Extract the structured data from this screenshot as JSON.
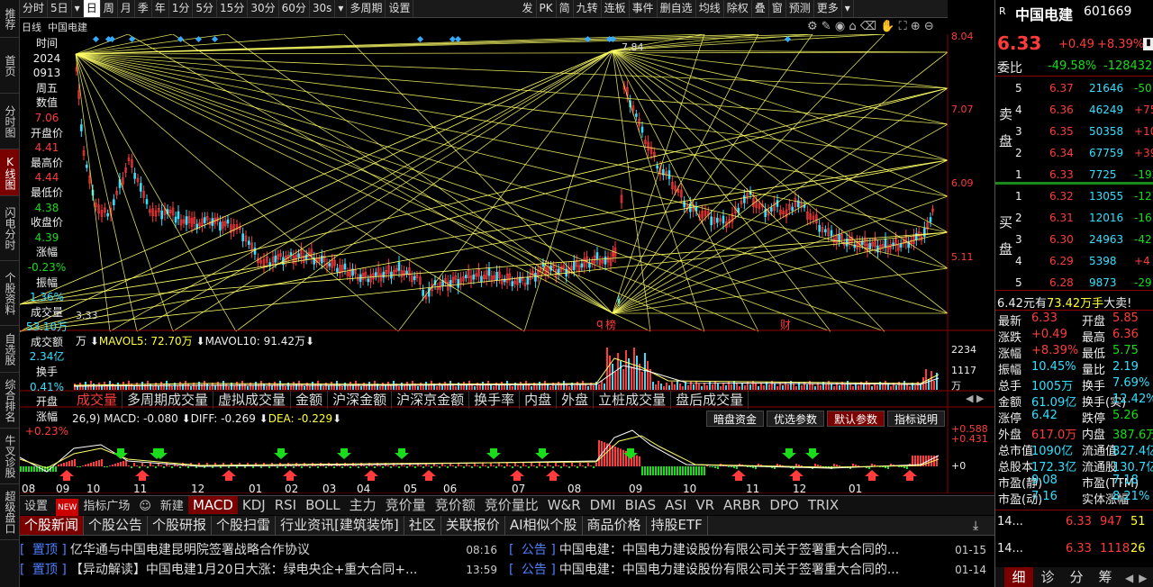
{
  "leftnav": [
    "推荐",
    "首页",
    "分时图",
    "K线图",
    "闪电分时",
    "个股资料",
    "自选股",
    "综合排名",
    "牛叉诊股",
    "超级盘口"
  ],
  "toolbar": {
    "periods": [
      "分时",
      "5日",
      "日",
      "周",
      "月",
      "季",
      "年",
      "1分",
      "5分",
      "15分",
      "30分",
      "60分",
      "30s",
      "多周期",
      "设置"
    ],
    "right": [
      "发",
      "PK",
      "简",
      "九转",
      "连板",
      "事件",
      "删自选",
      "均线",
      "除权",
      "叠",
      "窗",
      "预测",
      "更多"
    ]
  },
  "chart": {
    "label_period": "日线",
    "label_name": "中国电建",
    "y_ticks": [
      "8.04",
      "7.07",
      "6.09",
      "5.11"
    ],
    "x_ticks": [
      "08",
      "09",
      "10",
      "11",
      "12",
      "01",
      "02",
      "03",
      "04",
      "05",
      "06",
      "07",
      "08",
      "09",
      "10",
      "11",
      "12",
      "01"
    ],
    "high_label": "7.84",
    "low_label": "3.33",
    "marks": [
      "q",
      "榜",
      "财"
    ]
  },
  "infocol": [
    {
      "t": "时间",
      "c": "wht"
    },
    {
      "t": "2024",
      "c": "wht"
    },
    {
      "t": "0913",
      "c": "wht"
    },
    {
      "t": "周五",
      "c": "wht"
    },
    {
      "t": "数值",
      "c": "wht"
    },
    {
      "t": "7.06",
      "c": "red"
    },
    {
      "t": "开盘价",
      "c": "wht"
    },
    {
      "t": "4.41",
      "c": "red"
    },
    {
      "t": "最高价",
      "c": "wht"
    },
    {
      "t": "4.44",
      "c": "red"
    },
    {
      "t": "最低价",
      "c": "wht"
    },
    {
      "t": "4.38",
      "c": "grn"
    },
    {
      "t": "收盘价",
      "c": "wht"
    },
    {
      "t": "4.39",
      "c": "grn"
    },
    {
      "t": "涨幅",
      "c": "wht"
    },
    {
      "t": "-0.23%",
      "c": "grn"
    },
    {
      "t": "振幅",
      "c": "wht"
    },
    {
      "t": "1.36%",
      "c": "cyn"
    },
    {
      "t": "成交量",
      "c": "wht"
    },
    {
      "t": "53.10万",
      "c": "cyn"
    },
    {
      "t": "成交额",
      "c": "wht"
    },
    {
      "t": "2.34亿",
      "c": "cyn"
    },
    {
      "t": "换手",
      "c": "wht"
    },
    {
      "t": "0.41%",
      "c": "cyn"
    },
    {
      "t": "开盘",
      "c": "wht"
    },
    {
      "t": "涨幅",
      "c": "wht"
    },
    {
      "t": "+0.23%",
      "c": "red"
    }
  ],
  "volume": {
    "legend_prefix": "万",
    "mavol5": "MAVOL5: 72.70万",
    "mavol10": "MAVOL10: 91.42万",
    "y_ticks": [
      "2234",
      "1117",
      "万"
    ],
    "tabs": [
      "成交量",
      "多周期成交量",
      "虚拟成交量",
      "金额",
      "沪深金额",
      "沪深京金额",
      "换手率",
      "内盘",
      "外盘",
      "立桩成交量",
      "盘后成交量"
    ]
  },
  "macd": {
    "params": "26,9)",
    "macd": "MACD: -0.080",
    "diff": "DIFF: -0.269",
    "dea": "DEA: -0.229",
    "buttons": [
      "暗盘资金",
      "优选参数",
      "默认参数",
      "指标说明"
    ],
    "y_ticks": [
      "+0.588",
      "+0.431",
      "+0"
    ]
  },
  "indicator_tabs": [
    "设置",
    "指标广场",
    "新建",
    "MACD",
    "KDJ",
    "RSI",
    "BOLL",
    "主力",
    "竞价量",
    "竞价额",
    "竞价量比",
    "W&R",
    "DMI",
    "BIAS",
    "ASI",
    "VR",
    "ARBR",
    "DPO",
    "TRIX"
  ],
  "new_badge": "NEW",
  "news_tabs": [
    "个股新闻",
    "个股公告",
    "个股研报",
    "个股扫雷",
    "行业资讯[建筑装饰]",
    "社区",
    "关联报价",
    "AI相似个股",
    "商品价格",
    "持股ETF"
  ],
  "news_left": [
    {
      "tag": "置顶",
      "title": "亿华通与中国电建昆明院签署战略合作协议",
      "time": "08:16"
    },
    {
      "tag": "置顶",
      "title": "【异动解读】中国电建1月20日大涨：绿电央企+重大合同+...",
      "time": "13:59"
    }
  ],
  "news_right": [
    {
      "tag": "公告",
      "title": "中国电建：中国电力建设股份有限公司关于签署重大合同的...",
      "time": "01-15"
    },
    {
      "tag": "公告",
      "title": "中国电建：中国电力建设股份有限公司关于签署重大合同的...",
      "time": "01-14"
    }
  ],
  "quote": {
    "r": "R",
    "name": "中国电建",
    "code": "601669",
    "price": "6.33",
    "change": "+0.49",
    "pct": "+8.39%",
    "weibi_label": "委比",
    "weibi": "-49.58%",
    "weicha": "-128432",
    "sell_label": [
      "卖",
      "盘"
    ],
    "buy_label": [
      "买",
      "盘"
    ],
    "sells": [
      {
        "n": "5",
        "p": "6.37",
        "v": "21646",
        "d": "-50"
      },
      {
        "n": "4",
        "p": "6.36",
        "v": "46249",
        "d": "+75"
      },
      {
        "n": "3",
        "p": "6.35",
        "v": "50358",
        "d": "+103"
      },
      {
        "n": "2",
        "p": "6.34",
        "v": "67759",
        "d": "+392"
      },
      {
        "n": "1",
        "p": "6.33",
        "v": "7725",
        "d": "-192"
      }
    ],
    "buys": [
      {
        "n": "1",
        "p": "6.32",
        "v": "13055",
        "d": "-127"
      },
      {
        "n": "2",
        "p": "6.31",
        "v": "12016",
        "d": "-16"
      },
      {
        "n": "3",
        "p": "6.30",
        "v": "24963",
        "d": "-42"
      },
      {
        "n": "4",
        "p": "6.29",
        "v": "5398",
        "d": "+4"
      },
      {
        "n": "5",
        "p": "6.28",
        "v": "9873",
        "d": "-29"
      }
    ],
    "bigbuy": "6.42元有",
    "bigbuy2": "73.42万手",
    "bigbuy3": "大卖!",
    "stats": [
      [
        "最新",
        "6.33",
        "开盘",
        "5.85"
      ],
      [
        "涨跌",
        "+0.49",
        "最高",
        "6.36"
      ],
      [
        "涨幅",
        "+8.39%",
        "最低",
        "5.75"
      ],
      [
        "振幅",
        "10.45%",
        "量比",
        "2.19"
      ],
      [
        "总手",
        "1005万",
        "换手",
        "7.69%"
      ],
      [
        "金额",
        "61.09亿",
        "换手(实)",
        "12.42%"
      ],
      [
        "涨停",
        "6.42",
        "跌停",
        "5.26"
      ],
      [
        "外盘",
        "617.0万",
        "内盘",
        "387.6万"
      ],
      [
        "总市值",
        "1090亿",
        "流通值",
        "827.4亿"
      ],
      [
        "总股本",
        "172.3亿",
        "流通股",
        "130.7亿"
      ],
      [
        "市盈(静)",
        "9.08",
        "市盈(TTM)",
        "7.18"
      ],
      [
        "市盈(动)",
        "7.16",
        "实体涨幅",
        "8.21%"
      ]
    ],
    "ticks": [
      {
        "t": "14...",
        "p": "6.33",
        "v": "947",
        "x": "51"
      },
      {
        "t": "14...",
        "p": "6.33",
        "v": "1118",
        "x": "26"
      }
    ],
    "bottom_tabs": [
      "细",
      "诊",
      "分",
      "筹"
    ]
  }
}
